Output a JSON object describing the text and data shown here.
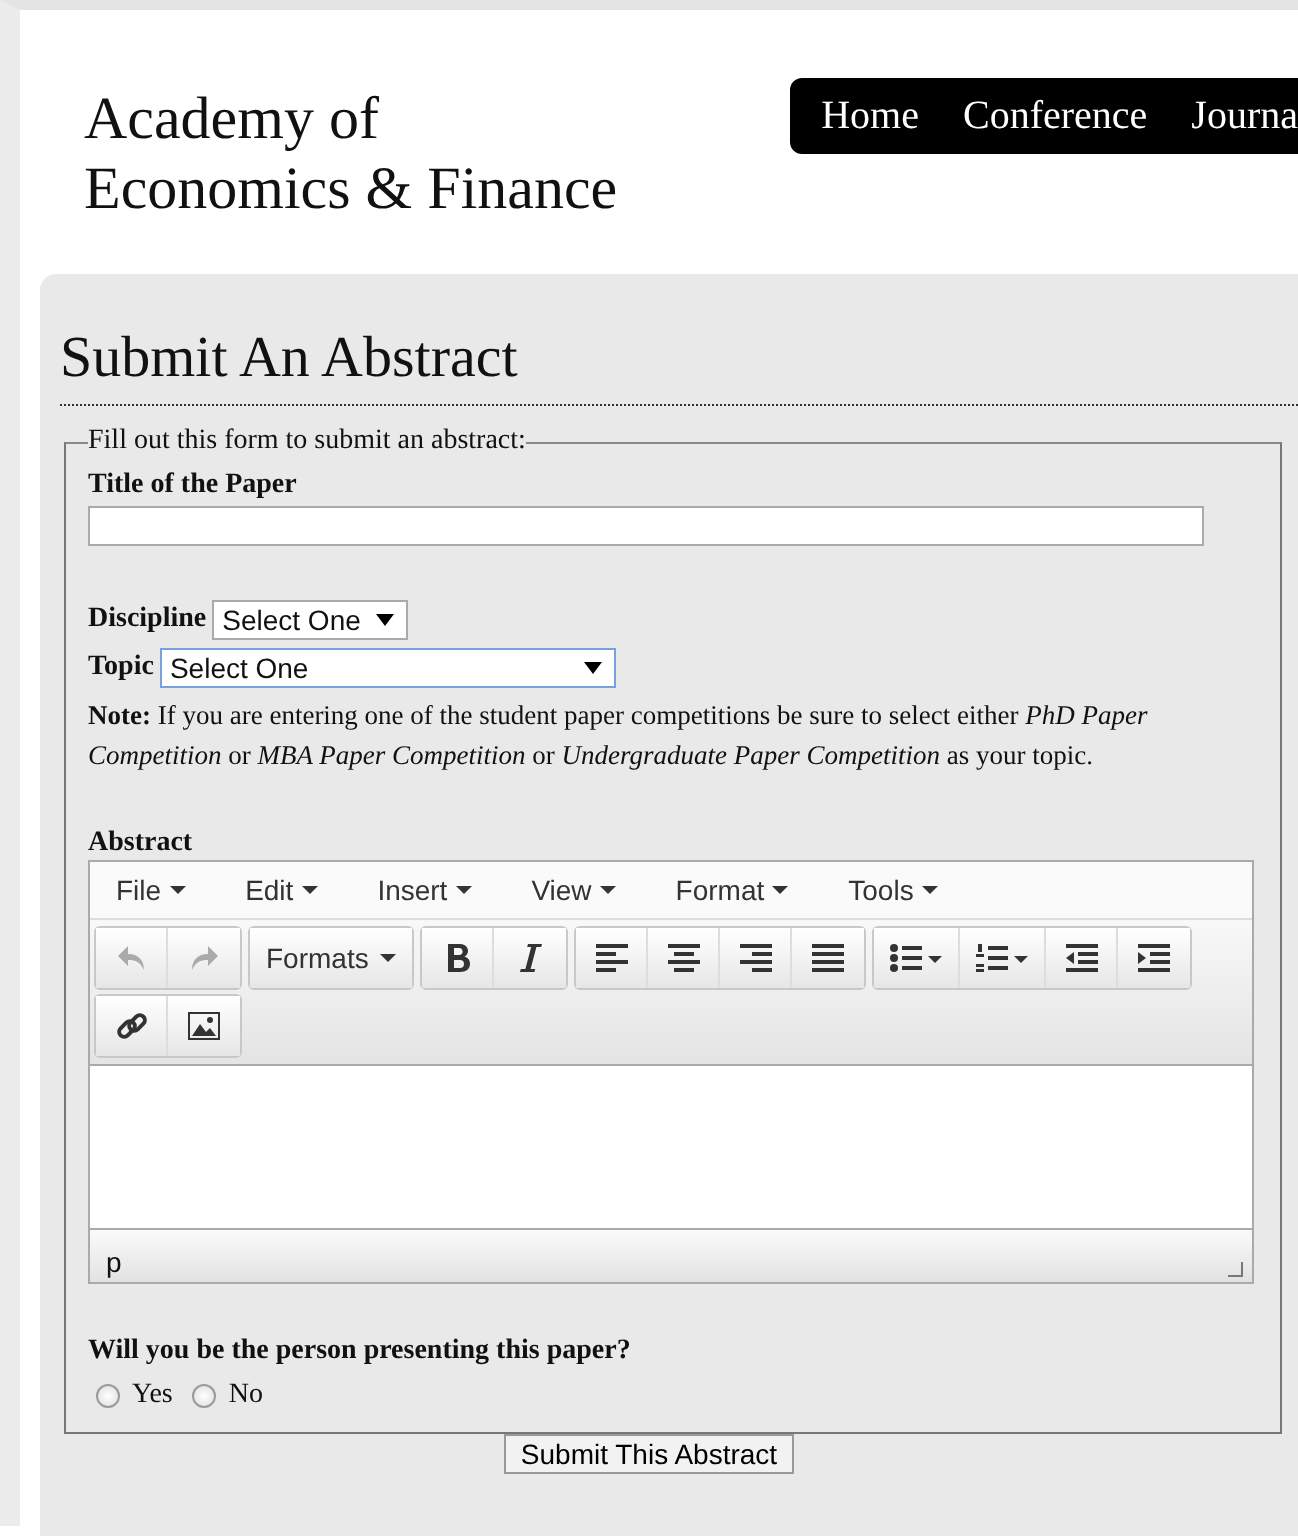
{
  "site": {
    "title_lines": [
      "Academy of",
      "Economics & Finance"
    ]
  },
  "nav": {
    "items": [
      {
        "label": "Home"
      },
      {
        "label": "Conference"
      },
      {
        "label": "Journa"
      }
    ]
  },
  "page": {
    "heading": "Submit An Abstract"
  },
  "form": {
    "legend": "Fill out this form to submit an abstract:",
    "title_label": "Title of the Paper",
    "discipline": {
      "label": "Discipline",
      "value": "Select One",
      "focused": false
    },
    "topic": {
      "label": "Topic",
      "value": "Select One",
      "focused": true
    },
    "note": "**Note:** If you are entering one of the student paper competitions be sure to select either *PhD Paper Competition* or *MBA Paper Competition* or *Undergraduate Paper Competition* as your topic.",
    "abstract_label": "Abstract",
    "editor": {
      "menus": [
        "File",
        "Edit",
        "Insert",
        "View",
        "Format",
        "Tools"
      ],
      "toolbar": [
        [
          {
            "kind": "undo",
            "disabled": true
          },
          {
            "kind": "redo",
            "disabled": true
          }
        ],
        [
          {
            "kind": "formats",
            "label": "Formats",
            "disabled": false
          }
        ],
        [
          {
            "kind": "bold",
            "disabled": false
          },
          {
            "kind": "italic",
            "disabled": false
          }
        ],
        [
          {
            "kind": "align-left",
            "disabled": false
          },
          {
            "kind": "align-center",
            "disabled": false
          },
          {
            "kind": "align-right",
            "disabled": false
          },
          {
            "kind": "justify",
            "disabled": false
          }
        ],
        [
          {
            "kind": "bullet-list",
            "disabled": false
          },
          {
            "kind": "numbered-list",
            "disabled": false
          },
          {
            "kind": "outdent",
            "disabled": false
          },
          {
            "kind": "indent",
            "disabled": false
          }
        ],
        [
          {
            "kind": "link",
            "disabled": false
          },
          {
            "kind": "image",
            "disabled": false
          }
        ]
      ],
      "path": "p"
    },
    "question": "Will you be the person presenting this paper?",
    "options": [
      {
        "label": "Yes",
        "selected": false
      },
      {
        "label": "No",
        "selected": false
      }
    ],
    "submit": "Submit This Abstract"
  }
}
